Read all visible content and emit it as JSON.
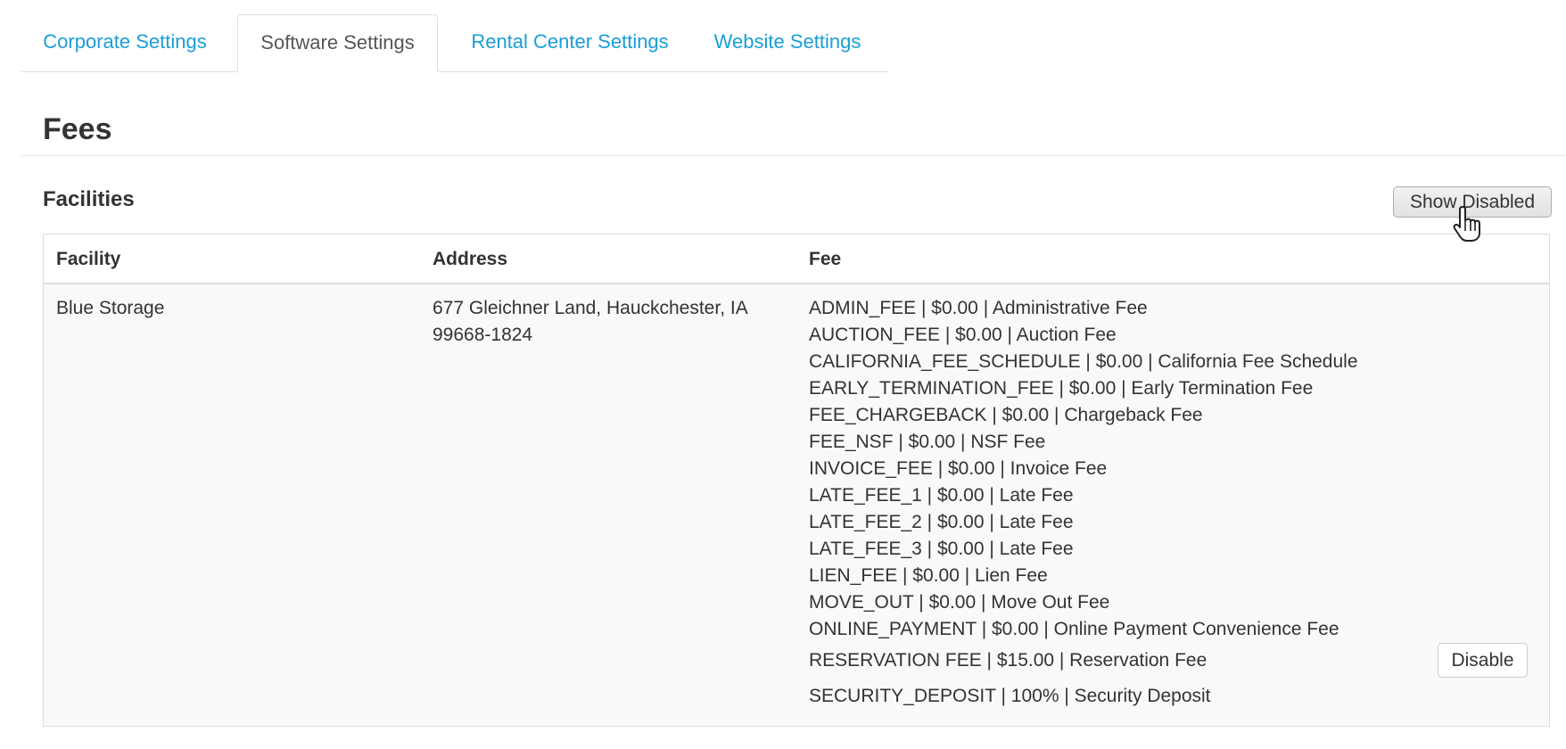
{
  "tabs": [
    {
      "label": "Corporate Settings",
      "active": false
    },
    {
      "label": "Software Settings",
      "active": true
    },
    {
      "label": "Rental Center Settings",
      "active": false
    },
    {
      "label": "Website Settings",
      "active": false
    }
  ],
  "page": {
    "title": "Fees"
  },
  "facilities": {
    "title": "Facilities",
    "show_disabled_label": "Show Disabled",
    "columns": [
      "Facility",
      "Address",
      "Fee"
    ],
    "rows": [
      {
        "facility": "Blue Storage",
        "address": "677 Gleichner Land, Hauckchester, IA 99668-1824",
        "fees": [
          "ADMIN_FEE | $0.00 | Administrative Fee",
          "AUCTION_FEE | $0.00 | Auction Fee",
          "CALIFORNIA_FEE_SCHEDULE | $0.00 | California Fee Schedule",
          "EARLY_TERMINATION_FEE | $0.00 | Early Termination Fee",
          "FEE_CHARGEBACK | $0.00 | Chargeback Fee",
          "FEE_NSF | $0.00 | NSF Fee",
          "INVOICE_FEE | $0.00 | Invoice Fee",
          "LATE_FEE_1 | $0.00 | Late Fee",
          "LATE_FEE_2 | $0.00 | Late Fee",
          "LATE_FEE_3 | $0.00 | Late Fee",
          "LIEN_FEE | $0.00 | Lien Fee",
          "MOVE_OUT | $0.00 | Move Out Fee",
          "ONLINE_PAYMENT | $0.00 | Online Payment Convenience Fee",
          "RESERVATION FEE | $15.00 | Reservation Fee",
          "SECURITY_DEPOSIT | 100% | Security Deposit"
        ],
        "disable_label": "Disable"
      }
    ]
  },
  "icons": {
    "cursor": "hand-pointer-cursor-icon"
  },
  "colors": {
    "link": "#1a9dd9",
    "border": "#dddddd",
    "row_bg": "#f9f9f9"
  }
}
